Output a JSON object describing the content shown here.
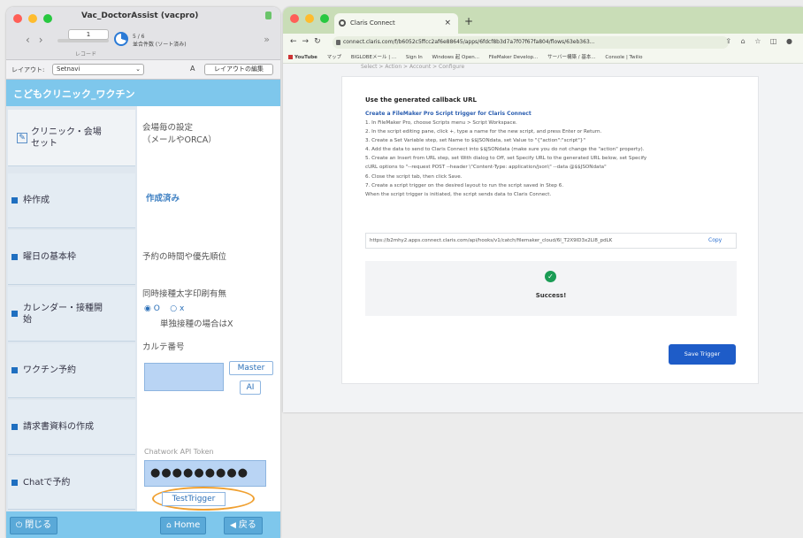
{
  "filemaker": {
    "window_title": "Vac_DoctorAssist (vacpro)",
    "record_input": "1",
    "record_label": "レコード",
    "found_count": "5 / 6",
    "found_sub": "並合件数 (ソート済み)",
    "layout_label": "レイアウト:",
    "layout_value": "Setnavi",
    "aa_label": "A",
    "edit_layout_label": "レイアウトの編集",
    "app_title": "こどもクリニック_ワクチン",
    "sidebar": [
      {
        "label": "クリニック・会場\nセット"
      },
      {
        "label": "枠作成"
      },
      {
        "label": "曜日の基本枠"
      },
      {
        "label": "カレンダー・接種開\n始"
      },
      {
        "label": "ワクチン予約"
      },
      {
        "label": "請求書資料の作成"
      },
      {
        "label": "Chatで予約"
      }
    ],
    "content": {
      "venue_settings": "会場毎の設定\n（メールやORCA）",
      "created": "作成済み",
      "reservation_time": "予約の時間や優先順位",
      "concurrent_print": "同時接種太字印刷有無",
      "radio_on": "◉ O",
      "radio_off": "○ x",
      "single_dose_note": "単独接種の場合はX",
      "chart_number": "カルテ番号",
      "master_button": "Master",
      "ai_button": "AI",
      "chatwork_label": "Chatwork API Token",
      "token_value": "●●●●●●●●●",
      "test_trigger": "TestTrigger"
    },
    "footer": {
      "close_label": "閉じる",
      "home_label": "Home",
      "back_label": "戻る"
    }
  },
  "browser": {
    "tab_title": "Claris Connect",
    "url": "connect.claris.com/f/b6052c5ffcc2af6e88645/apps/6fdcf8b3d7a7f07f67fa804/flows/63eb363...",
    "bookmarks": [
      "YouTube",
      "マップ",
      "BIGLOBEメール | ...",
      "Sign In",
      "Windows 起 Open...",
      "FileMaker Develop...",
      "サーバー構築 / 基本...",
      "Console | Twilio"
    ],
    "breadcrumbs": "Select  >  Action  >  Account  >  Configure",
    "heading": "Use the generated callback URL",
    "subheading": "Create a FileMaker Pro Script trigger for Claris Connect",
    "steps": [
      "1. In FileMaker Pro, choose Scripts menu > Script Workspace.",
      "2. In the script editing pane, click +, type a name for the new script, and press Enter or Return.",
      "3. Create a Set Variable step, set Name to $$JSONdata, set Value to \"{\"action\":\"script\"}\"",
      "4. Add the data to send to Claris Connect into $$JSONdata (make sure you do not change the \"action\" property).",
      "5. Create an Insert from URL step, set With dialog to Off, set Specify URL to the generated URL below, set Specify",
      "   cURL options to \"--request POST --header \\\"Content-Type: application/json\\\" --data @$$JSONdata\"",
      "6. Close the script tab, then click Save.",
      "7. Create a script trigger on the desired layout to run the script saved in Step 6.",
      "   When the script trigger is initiated, the script sends data to Claris Connect."
    ],
    "callback_url": "https://b2mhy2.apps.connect.claris.com/api/hooks/v1/catch/filemaker_cloud/6l_T2X9ID3x2Ll8_pdLK",
    "copy_label": "Copy",
    "success_label": "Success!",
    "save_trigger_label": "Save Trigger"
  }
}
